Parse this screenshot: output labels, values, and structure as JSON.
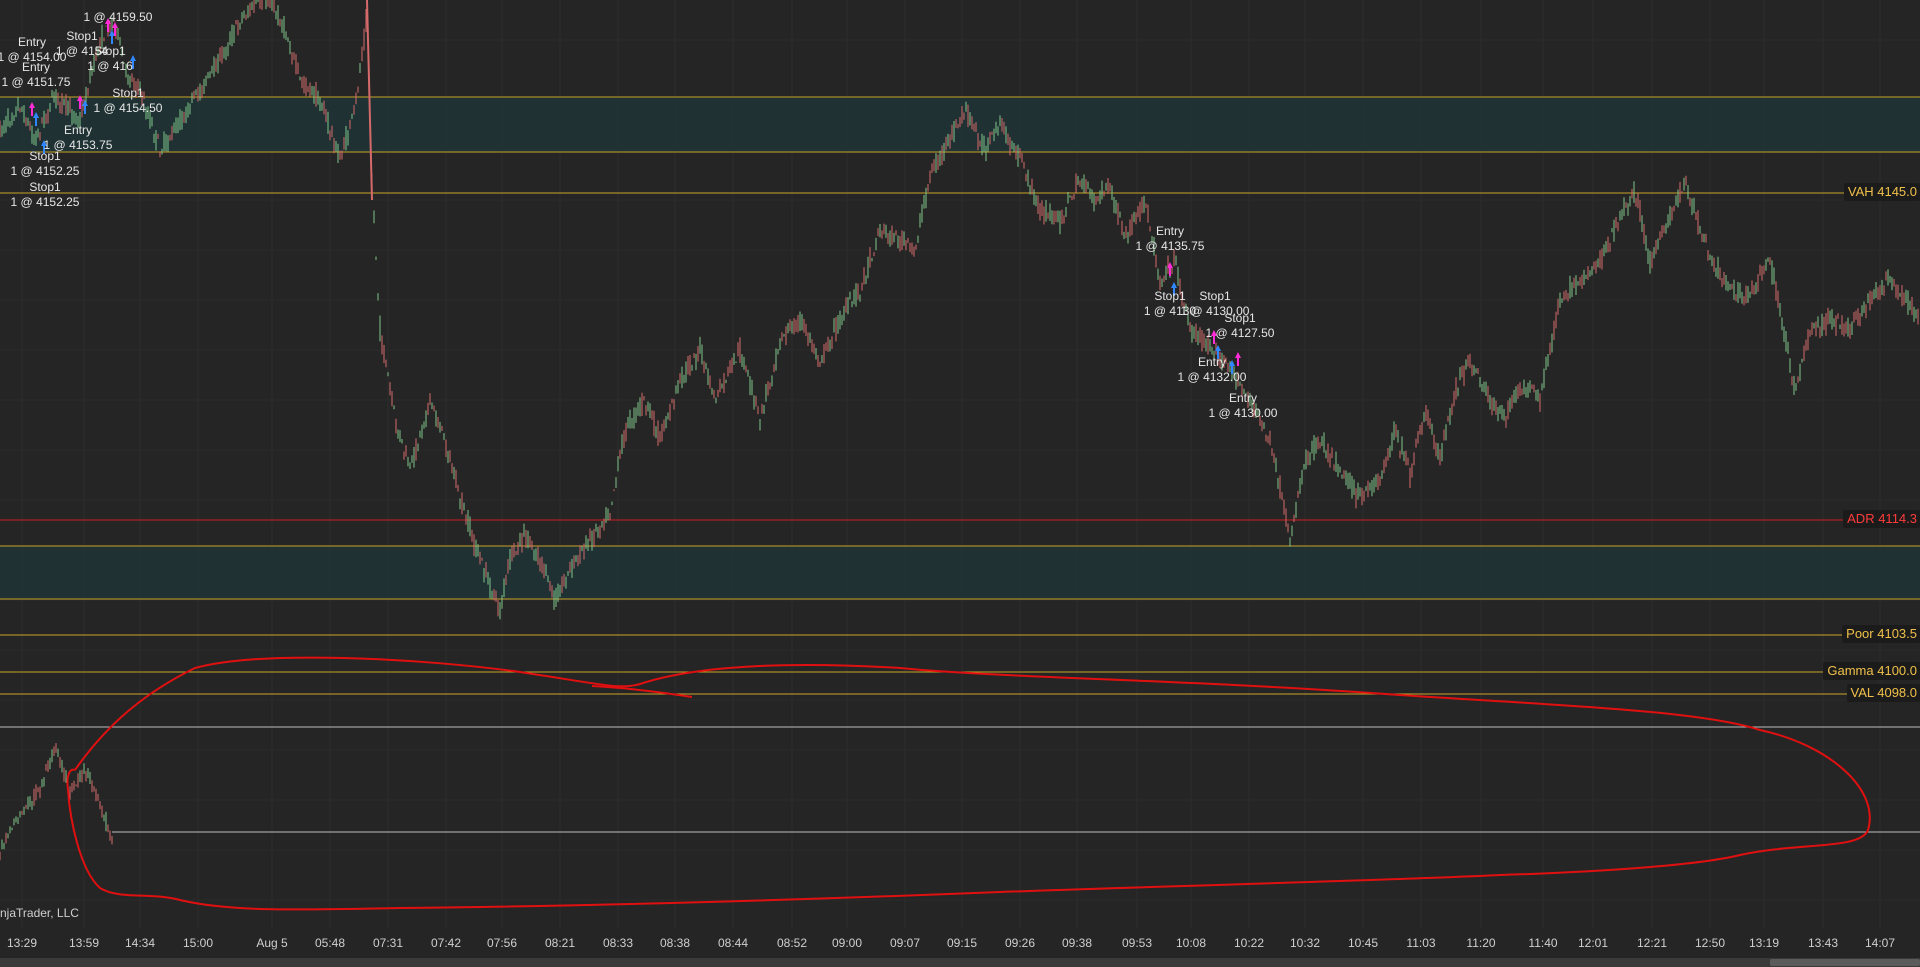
{
  "app": {
    "copyright": "njaTrader, LLC"
  },
  "levels": [
    {
      "id": "vah",
      "label": "VAH 4145.0",
      "color": "#f0c04a"
    },
    {
      "id": "adr",
      "label": "ADR 4114.3",
      "color": "#ff3b3b"
    },
    {
      "id": "poor",
      "label": "Poor 4103.5",
      "color": "#f0c04a"
    },
    {
      "id": "gamma",
      "label": "Gamma 4100.0",
      "color": "#f0c04a"
    },
    {
      "id": "val",
      "label": "VAL 4098.0",
      "color": "#f0c04a"
    }
  ],
  "time_axis": [
    "13:29",
    "13:59",
    "14:34",
    "15:00",
    "Aug 5",
    "05:48",
    "07:31",
    "07:42",
    "07:56",
    "08:21",
    "08:33",
    "08:38",
    "08:44",
    "08:52",
    "09:00",
    "09:07",
    "09:15",
    "09:26",
    "09:38",
    "09:53",
    "10:08",
    "10:22",
    "10:32",
    "10:45",
    "11:03",
    "11:20",
    "11:40",
    "12:01",
    "12:21",
    "12:50",
    "13:19",
    "13:43",
    "14:07"
  ],
  "trade_labels": [
    {
      "line1": "Entry",
      "line2": "1 @ 4154.00"
    },
    {
      "line1": "Entry",
      "line2": "1 @ 4151.75"
    },
    {
      "line1": "Stop1",
      "line2": "1 @ 4154"
    },
    {
      "line1": "Stop1",
      "line2": "1 @ 416"
    },
    {
      "line1": "Stop1",
      "line2": "1 @ 4154.50"
    },
    {
      "line1": "",
      "line2": "1 @ 4159.50"
    },
    {
      "line1": "Entry",
      "line2": "1 @ 4153.75"
    },
    {
      "line1": "Stop1",
      "line2": "1 @ 4152.25"
    },
    {
      "line1": "Stop1",
      "line2": "1 @ 4152.25"
    },
    {
      "line1": "Entry",
      "line2": "1 @ 4135.75"
    },
    {
      "line1": "Stop1",
      "line2": "1 @ 4130"
    },
    {
      "line1": "Stop1",
      "line2": "1 @ 4130.00"
    },
    {
      "line1": "Stop1",
      "line2": "1 @ 4127.50"
    },
    {
      "line1": "Entry",
      "line2": "1 @ 4132.00"
    },
    {
      "line1": "Entry",
      "line2": "1 @ 4130.00"
    }
  ],
  "colors": {
    "background": "#252525",
    "level_line": "#c9a227",
    "adr_line": "#d02020",
    "value_band": "#1f3436",
    "candle_up": "#7fc58a",
    "candle_down": "#d46a6a",
    "annotation": "#e01010",
    "entry_marker": "#ff2bd6",
    "stop_marker": "#2f86ff"
  }
}
